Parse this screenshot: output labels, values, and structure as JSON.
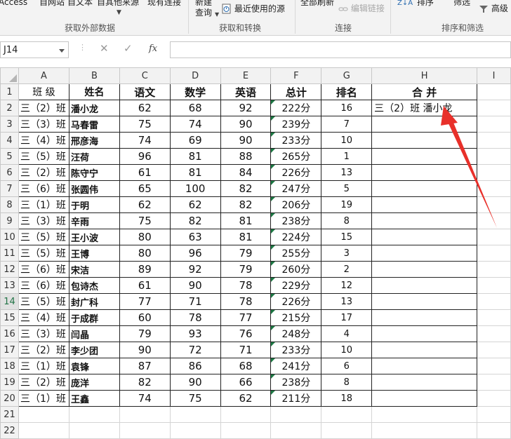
{
  "ribbon": {
    "access": "Access",
    "web": "自网站",
    "text": "自文本",
    "other_sources": "自其他来源",
    "existing_conn": "现有连接",
    "new_query_line1": "新建",
    "new_query_line2": "查询",
    "recent_sources": "最近使用的源",
    "refresh_all": "全部刷新",
    "edit_links": "编辑链接",
    "sort": "排序",
    "filter": "筛选",
    "advanced": "高级",
    "group_external": "获取外部数据",
    "group_transform": "获取和转换",
    "group_connections": "连接",
    "group_sort_filter": "排序和筛选"
  },
  "formula_bar": {
    "name_box": "J14",
    "cancel": "✕",
    "confirm": "✓",
    "fx": "fx",
    "formula": ""
  },
  "columns": [
    "A",
    "B",
    "C",
    "D",
    "E",
    "F",
    "G",
    "H",
    "I"
  ],
  "headers": {
    "class": "班  级",
    "name": "姓名",
    "chinese": "语文",
    "math": "数学",
    "english": "英语",
    "total": "总计",
    "rank": "排名",
    "merge": "合    并"
  },
  "rows": [
    {
      "r": "2",
      "cls": "三（2）班",
      "name": "潘小龙",
      "c": "62",
      "m": "68",
      "e": "92",
      "t": "222分",
      "rk": "16",
      "merge": "三（2）班 潘小龙"
    },
    {
      "r": "3",
      "cls": "三（3）班",
      "name": "马春雷",
      "c": "75",
      "m": "74",
      "e": "90",
      "t": "239分",
      "rk": "7",
      "merge": ""
    },
    {
      "r": "4",
      "cls": "三（4）班",
      "name": "邢彦海",
      "c": "74",
      "m": "69",
      "e": "90",
      "t": "233分",
      "rk": "10",
      "merge": ""
    },
    {
      "r": "5",
      "cls": "三（5）班",
      "name": "汪荷",
      "c": "96",
      "m": "81",
      "e": "88",
      "t": "265分",
      "rk": "1",
      "merge": ""
    },
    {
      "r": "6",
      "cls": "三（2）班",
      "name": "陈守宁",
      "c": "61",
      "m": "81",
      "e": "84",
      "t": "226分",
      "rk": "13",
      "merge": ""
    },
    {
      "r": "7",
      "cls": "三（6）班",
      "name": "张圆伟",
      "c": "65",
      "m": "100",
      "e": "82",
      "t": "247分",
      "rk": "5",
      "merge": ""
    },
    {
      "r": "8",
      "cls": "三（1）班",
      "name": "于明",
      "c": "62",
      "m": "62",
      "e": "82",
      "t": "206分",
      "rk": "19",
      "merge": ""
    },
    {
      "r": "9",
      "cls": "三（3）班",
      "name": "辛雨",
      "c": "75",
      "m": "82",
      "e": "81",
      "t": "238分",
      "rk": "8",
      "merge": ""
    },
    {
      "r": "10",
      "cls": "三（5）班",
      "name": "王小波",
      "c": "80",
      "m": "63",
      "e": "81",
      "t": "224分",
      "rk": "15",
      "merge": ""
    },
    {
      "r": "11",
      "cls": "三（5）班",
      "name": "王博",
      "c": "80",
      "m": "96",
      "e": "79",
      "t": "255分",
      "rk": "3",
      "merge": ""
    },
    {
      "r": "12",
      "cls": "三（6）班",
      "name": "宋洁",
      "c": "89",
      "m": "92",
      "e": "79",
      "t": "260分",
      "rk": "2",
      "merge": ""
    },
    {
      "r": "13",
      "cls": "三（6）班",
      "name": "包诗杰",
      "c": "61",
      "m": "90",
      "e": "78",
      "t": "229分",
      "rk": "12",
      "merge": ""
    },
    {
      "r": "14",
      "cls": "三（5）班",
      "name": "封广科",
      "c": "77",
      "m": "71",
      "e": "78",
      "t": "226分",
      "rk": "13",
      "merge": ""
    },
    {
      "r": "15",
      "cls": "三（4）班",
      "name": "于成群",
      "c": "60",
      "m": "78",
      "e": "77",
      "t": "215分",
      "rk": "17",
      "merge": ""
    },
    {
      "r": "16",
      "cls": "三（3）班",
      "name": "闫晶",
      "c": "79",
      "m": "93",
      "e": "76",
      "t": "248分",
      "rk": "4",
      "merge": ""
    },
    {
      "r": "17",
      "cls": "三（2）班",
      "name": "李少团",
      "c": "90",
      "m": "72",
      "e": "71",
      "t": "233分",
      "rk": "10",
      "merge": ""
    },
    {
      "r": "18",
      "cls": "三（1）班",
      "name": "袁锋",
      "c": "87",
      "m": "86",
      "e": "68",
      "t": "241分",
      "rk": "6",
      "merge": ""
    },
    {
      "r": "19",
      "cls": "三（2）班",
      "name": "庞洋",
      "c": "82",
      "m": "90",
      "e": "66",
      "t": "238分",
      "rk": "8",
      "merge": ""
    },
    {
      "r": "20",
      "cls": "三（1）班",
      "name": "王鑫",
      "c": "74",
      "m": "75",
      "e": "62",
      "t": "211分",
      "rk": "18",
      "merge": ""
    }
  ],
  "extra_rows": [
    "21",
    "22"
  ],
  "header_row_num": "1",
  "active_row": "14",
  "colors": {
    "accent_green": "#217346",
    "annotation_arrow": "#e8302a"
  }
}
